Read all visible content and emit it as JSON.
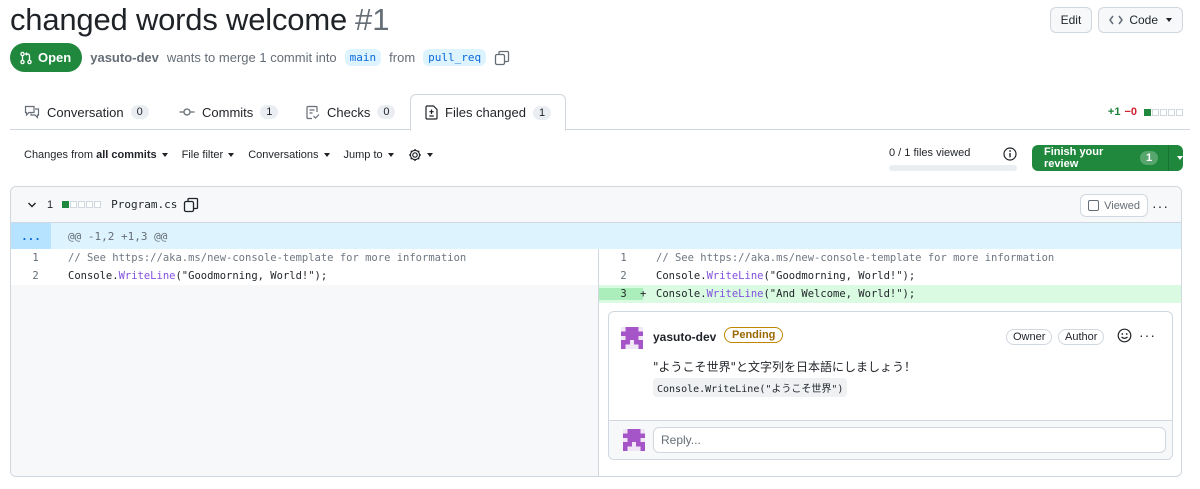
{
  "header": {
    "title": "changed words welcome",
    "number": "#1",
    "edit_label": "Edit",
    "code_label": "Code"
  },
  "state": {
    "badge": "Open",
    "author": "yasuto-dev",
    "text_merge": "wants to merge 1 commit into",
    "base_branch": "main",
    "text_from": "from",
    "head_branch": "pull_req"
  },
  "tabs": [
    {
      "label": "Conversation",
      "count": "0"
    },
    {
      "label": "Commits",
      "count": "1"
    },
    {
      "label": "Checks",
      "count": "0"
    },
    {
      "label": "Files changed",
      "count": "1"
    }
  ],
  "diffstat": {
    "additions": "+1",
    "deletions": "−0"
  },
  "toolbar": {
    "changes_from_prefix": "Changes from",
    "changes_from_value": "all commits",
    "file_filter": "File filter",
    "conversations": "Conversations",
    "jump_to": "Jump to"
  },
  "viewed_progress": {
    "text": "0 / 1 files viewed",
    "fraction": 0
  },
  "finish_review": {
    "label": "Finish your review",
    "count": "1"
  },
  "file": {
    "change_count": "1",
    "name": "Program.cs",
    "viewed_label": "Viewed",
    "hunk_expand": "...",
    "hunk_header": "@@ -1,2 +1,3 @@"
  },
  "diff": {
    "left": [
      {
        "num": "1",
        "tokens": [
          {
            "t": "// See https://aka.ms/new-console-template for more information",
            "c": "cmt"
          }
        ]
      },
      {
        "num": "2",
        "tokens": [
          {
            "t": "Console.",
            "c": ""
          },
          {
            "t": "WriteLine",
            "c": "mth"
          },
          {
            "t": "(\"Goodmorning, World!\");",
            "c": ""
          }
        ]
      }
    ],
    "right": [
      {
        "num": "1",
        "tokens": [
          {
            "t": "// See https://aka.ms/new-console-template for more information",
            "c": "cmt"
          }
        ]
      },
      {
        "num": "2",
        "tokens": [
          {
            "t": "Console.",
            "c": ""
          },
          {
            "t": "WriteLine",
            "c": "mth"
          },
          {
            "t": "(\"Goodmorning, World!\");",
            "c": ""
          }
        ]
      },
      {
        "num": "3",
        "added": true,
        "tokens": [
          {
            "t": "Console.",
            "c": ""
          },
          {
            "t": "WriteLine",
            "c": "mth"
          },
          {
            "t": "(\"And Welcome, World!\");",
            "c": ""
          }
        ]
      }
    ]
  },
  "comment": {
    "author": "yasuto-dev",
    "status": "Pending",
    "roles": [
      "Owner",
      "Author"
    ],
    "body": "\"ようこそ世界\"と文字列を日本語にしましょう！",
    "code": "Console.WriteLine(\"ようこそ世界\")",
    "reply_placeholder": "Reply..."
  },
  "colors": {
    "primary_green": "#1f883d",
    "added_bg": "#dafbe1",
    "hunk_bg": "#ddf4ff",
    "link_blue": "#0969da",
    "pending_gold": "#9a6700"
  }
}
